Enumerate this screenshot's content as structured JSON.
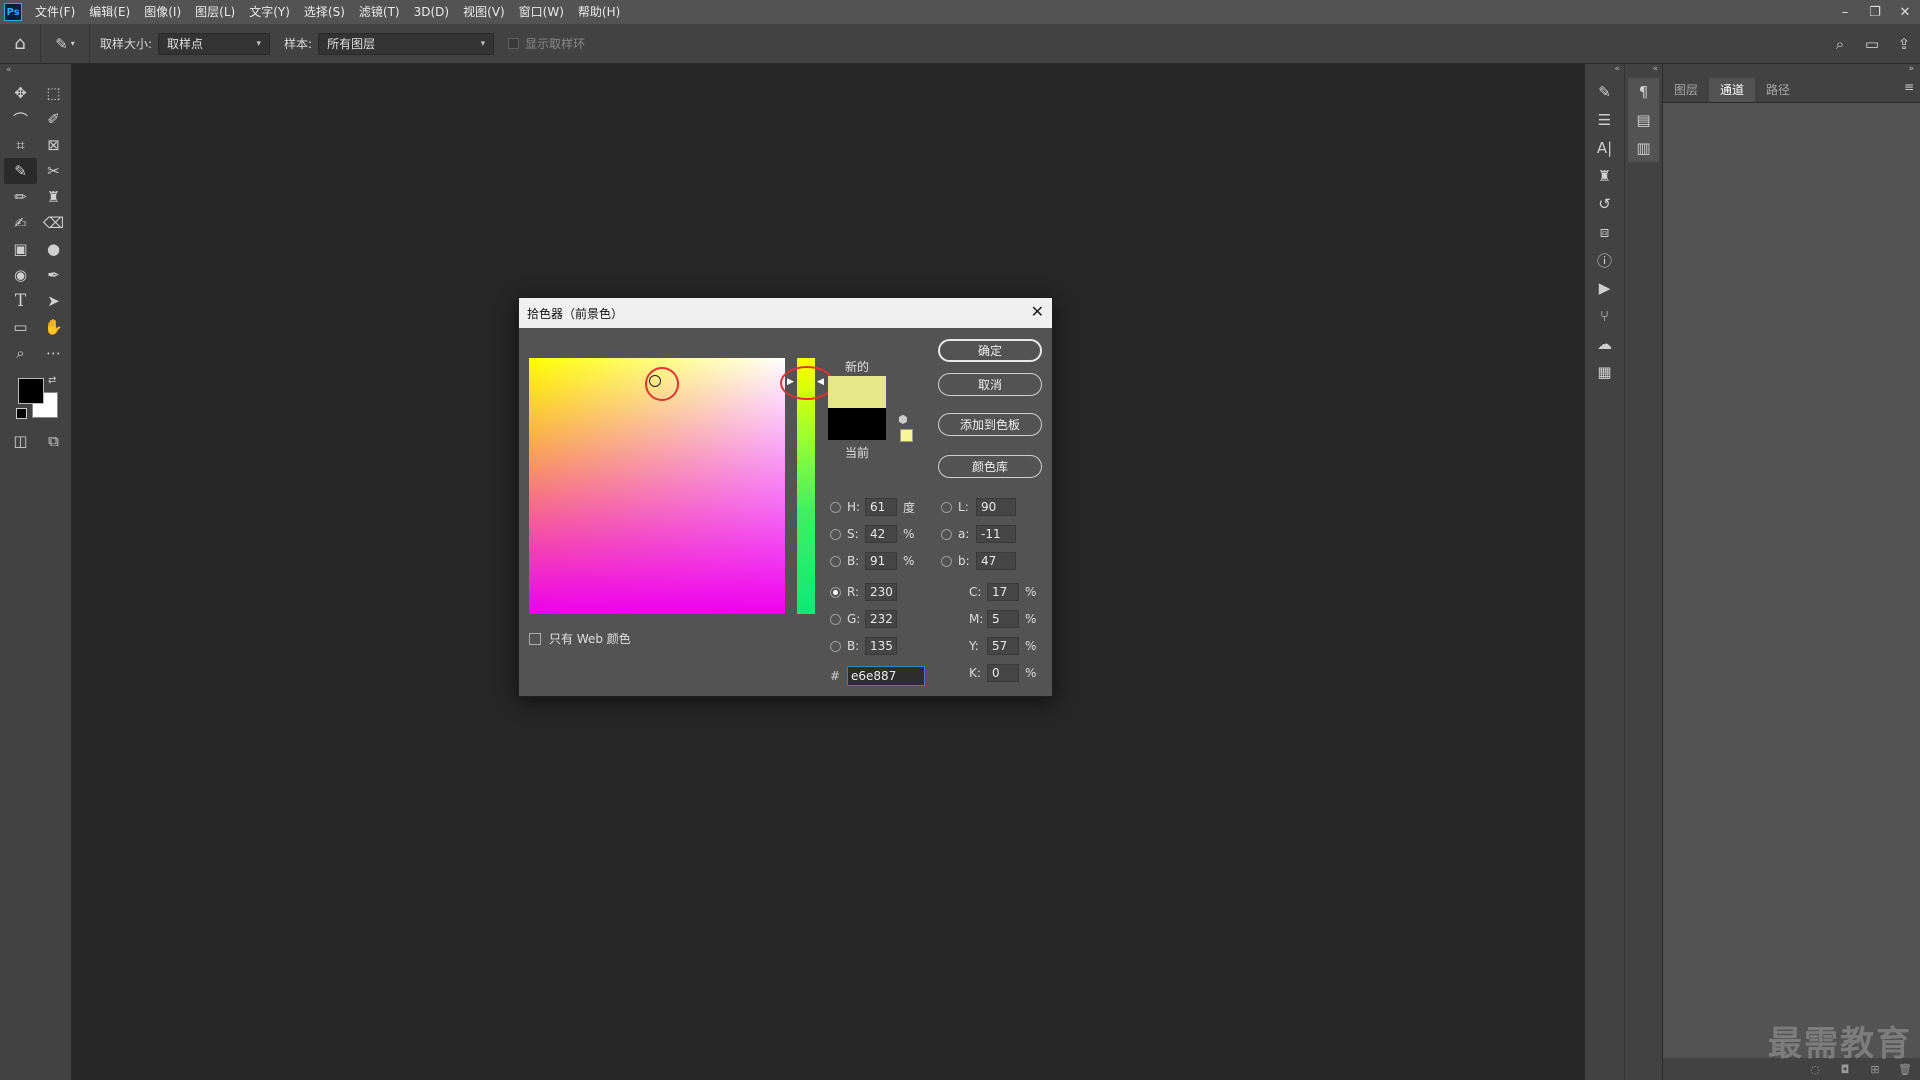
{
  "app": {
    "logo": "Ps"
  },
  "menu": [
    "文件(F)",
    "编辑(E)",
    "图像(I)",
    "图层(L)",
    "文字(Y)",
    "选择(S)",
    "滤镜(T)",
    "3D(D)",
    "视图(V)",
    "窗口(W)",
    "帮助(H)"
  ],
  "window_controls": {
    "minimize": "–",
    "restore": "❐",
    "close": "✕"
  },
  "options": {
    "sample_size_label": "取样大小:",
    "sample_size_value": "取样点",
    "sample_label": "样本:",
    "sample_value": "所有图层",
    "show_ring_label": "显示取样环"
  },
  "panel": {
    "tabs": [
      "图层",
      "通道",
      "路径"
    ],
    "active_tab": "通道",
    "menu_icon": "≡"
  },
  "watermark": "最需教育",
  "dialog": {
    "title": "拾色器（前景色）",
    "close": "✕",
    "new_label": "新的",
    "current_label": "当前",
    "new_color": "#e6e887",
    "current_color": "#000000",
    "buttons": {
      "ok": "确定",
      "cancel": "取消",
      "add_swatch": "添加到色板",
      "libraries": "颜色库"
    },
    "web_only_label": "只有 Web 颜色",
    "hsb": {
      "h_label": "H:",
      "h": "61",
      "h_unit": "度",
      "s_label": "S:",
      "s": "42",
      "s_unit": "%",
      "b_label": "B:",
      "b": "91",
      "b_unit": "%"
    },
    "lab": {
      "l_label": "L:",
      "l": "90",
      "a_label": "a:",
      "a": "-11",
      "b_label": "b:",
      "b": "47"
    },
    "rgb": {
      "r_label": "R:",
      "r": "230",
      "g_label": "G:",
      "g": "232",
      "b_label": "B:",
      "b": "135"
    },
    "cmyk": {
      "c_label": "C:",
      "c": "17",
      "m_label": "M:",
      "m": "5",
      "y_label": "Y:",
      "y": "57",
      "k_label": "K:",
      "k": "0",
      "unit": "%"
    },
    "hex_label": "#",
    "hex": "e6e887"
  }
}
